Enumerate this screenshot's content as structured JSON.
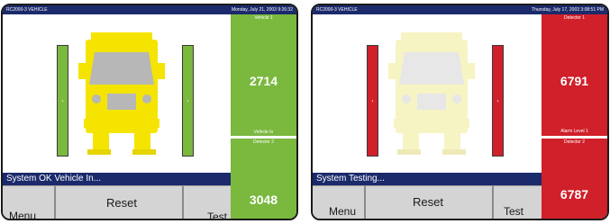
{
  "screens": [
    {
      "title_left": "RC2000-3 VEHICLE",
      "title_right": "Monday, July 21, 2003 9:26:32",
      "status": "System OK Vehicle In...",
      "buttons": {
        "menu": "Menu",
        "reset": "Reset",
        "test": "Test"
      },
      "left_arrow": "‹",
      "right_arrow": "›",
      "panel_upper_label": "Vehicle 1",
      "panel_upper_value": "2714",
      "panel_mid_label": "Vehicle In",
      "panel_lower_label": "Detector 2",
      "panel_lower_value": "3048",
      "colors": {
        "bars": "#7ab83e",
        "truck": "#f5e400",
        "panel": "#7ab83e"
      }
    },
    {
      "title_left": "RC2000-3 VEHICLE",
      "title_right": "Thursday, July 17, 2003 3:08:51 PM",
      "status": "System Testing...",
      "buttons": {
        "menu": "Menu",
        "reset": "Reset",
        "test": "Test"
      },
      "left_arrow": "‹",
      "right_arrow": "›",
      "panel_upper_label": "Detector 1",
      "panel_upper_value": "6791",
      "panel_mid_label": "Alarm Level 1",
      "panel_lower_label": "Detector 2",
      "panel_lower_value": "6787",
      "colors": {
        "bars": "#d0202a",
        "truck": "#f7f4c4",
        "panel": "#d0202a"
      }
    }
  ]
}
